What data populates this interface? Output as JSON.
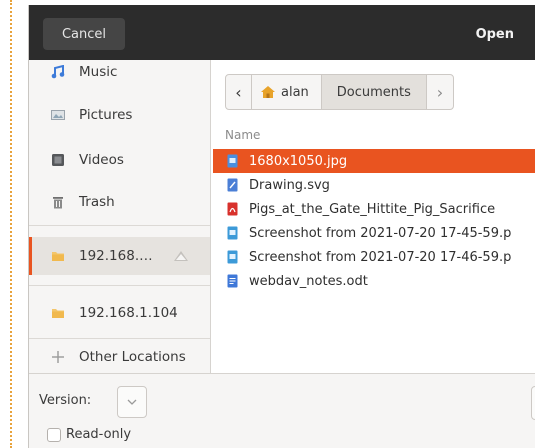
{
  "header": {
    "cancel_label": "Cancel",
    "open_label": "Open"
  },
  "sidebar": {
    "items": [
      {
        "label": "Music",
        "icon": "music-icon"
      },
      {
        "label": "Pictures",
        "icon": "pictures-icon"
      },
      {
        "label": "Videos",
        "icon": "videos-icon"
      },
      {
        "label": "Trash",
        "icon": "trash-icon"
      },
      {
        "label": "192.168.…",
        "icon": "network-folder-icon",
        "selected": true
      },
      {
        "label": "192.168.1.104",
        "icon": "network-folder-icon"
      },
      {
        "label": "Other Locations",
        "icon": "plus-icon"
      }
    ]
  },
  "pathbar": {
    "home_label": "alan",
    "current_label": "Documents"
  },
  "files": {
    "column_name": "Name",
    "items": [
      {
        "name": "1680x1050.jpg",
        "icon": "image-file-icon",
        "selected": true
      },
      {
        "name": "Drawing.svg",
        "icon": "drawing-file-icon"
      },
      {
        "name": "Pigs_at_the_Gate_Hittite_Pig_Sacrifice",
        "icon": "pdf-file-icon"
      },
      {
        "name": "Screenshot from 2021-07-20 17-45-59.p",
        "icon": "image-file-icon"
      },
      {
        "name": "Screenshot from 2021-07-20 17-46-59.p",
        "icon": "image-file-icon"
      },
      {
        "name": "webdav_notes.odt",
        "icon": "document-file-icon"
      }
    ]
  },
  "footer": {
    "version_label": "Version:",
    "readonly_label": "Read-only"
  },
  "colors": {
    "accent": "#e95420",
    "header_bg": "#2c2c2c"
  }
}
